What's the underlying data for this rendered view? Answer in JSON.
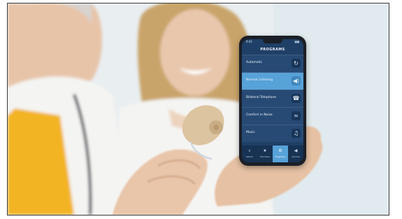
{
  "colors": {
    "screen_bg": "#1f3f66",
    "row_bg": "#274a74",
    "row_active": "#57a2d8",
    "tabbar_bg": "#173252",
    "aid_beige": "#dcc4a0",
    "coat_white": "#f4f4f2",
    "shirt_yellow": "#f2b420",
    "hair_blonde": "#c9a46b",
    "skin": "#e9c7ad"
  },
  "phone": {
    "status_time": "9:41",
    "status_battery": "▮▮▮",
    "title": "PROGRAMS",
    "items": [
      {
        "label": "Automatic",
        "icon": "auto-icon",
        "glyph": "↻"
      },
      {
        "label": "Normal Listening",
        "icon": "speaker-icon",
        "glyph": "◀)"
      },
      {
        "label": "Bilateral Telephone",
        "icon": "phone-icon",
        "glyph": "☎"
      },
      {
        "label": "Comfort in Noise",
        "icon": "noise-icon",
        "glyph": "≈"
      },
      {
        "label": "Music",
        "icon": "music-icon",
        "glyph": "♫"
      }
    ],
    "active_index": 1,
    "tabs": [
      {
        "label": "Search",
        "icon": "search-icon",
        "glyph": "⌕"
      },
      {
        "label": "Favorites",
        "icon": "star-icon",
        "glyph": "★"
      },
      {
        "label": "Programs",
        "icon": "programs-icon",
        "glyph": "⚙"
      },
      {
        "label": "Volume",
        "icon": "volume-icon",
        "glyph": "◀"
      }
    ],
    "active_tab": 2
  }
}
